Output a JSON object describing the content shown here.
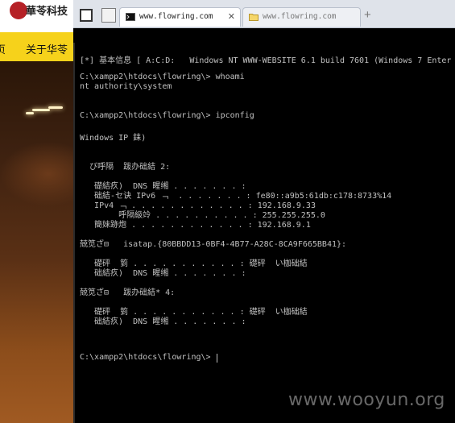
{
  "site": {
    "brand": "華苓科技",
    "nav_items": [
      "页",
      "关于华苓"
    ]
  },
  "browser": {
    "tabs": [
      {
        "label": "www.flowring.com",
        "active": true,
        "icon": "terminal-icon"
      },
      {
        "label": "www.flowring.com",
        "active": false,
        "icon": "folder-icon"
      }
    ],
    "new_tab": "+"
  },
  "console": {
    "lines": [
      "[*] 基本信息 [ A:C:D:   Windows NT WWW-WEBSITE 6.1 build 7601 (Windows 7 Enter",
      "",
      "C:\\xampp2\\htdocs\\flowring\\> whoami",
      "nt authority\\system",
      "",
      "",
      "C:\\xampp2\\htdocs\\flowring\\> ipconfig",
      "",
      "Windows IP 銇)",
      "",
      "",
      "  び呼隔  跋办础結 2:",
      "",
      "   礎結疚)  DNS 睲缃 . . . . . . . :",
      "   础結-セ诀 IPv6 ﹁  . . . . . . . : fe80::a9b5:61db:c178:8733%14",
      "   IPv4 ﹁ . . . . . . . . . . . . : 192.168.9.33",
      "        呼隔級竛 . . . . . . . . . . : 255.255.255.0",
      "   簡妹跡炮 . . . . . . . . . . . . : 192.168.9.1",
      "",
      "兢笕ざ⊟   isatap.{80BBDD13-0BF4-4B77-A28C-8CA9F665BB41}:",
      "",
      "   礎砰  箌 . . . . . . . . . . . : 礎砰  い枷础結",
      "   础結疚)  DNS 睲缃 . . . . . . . :",
      "",
      "兢笕ざ⊟   跋办础結* 4:",
      "",
      "   礎砰  箌 . . . . . . . . . . . : 礎砰  い枷础結",
      "   础結疚)  DNS 睲缃 . . . . . . . :",
      "",
      "",
      "",
      "C:\\xampp2\\htdocs\\flowring\\> "
    ]
  },
  "watermark": "www.wooyun.org"
}
